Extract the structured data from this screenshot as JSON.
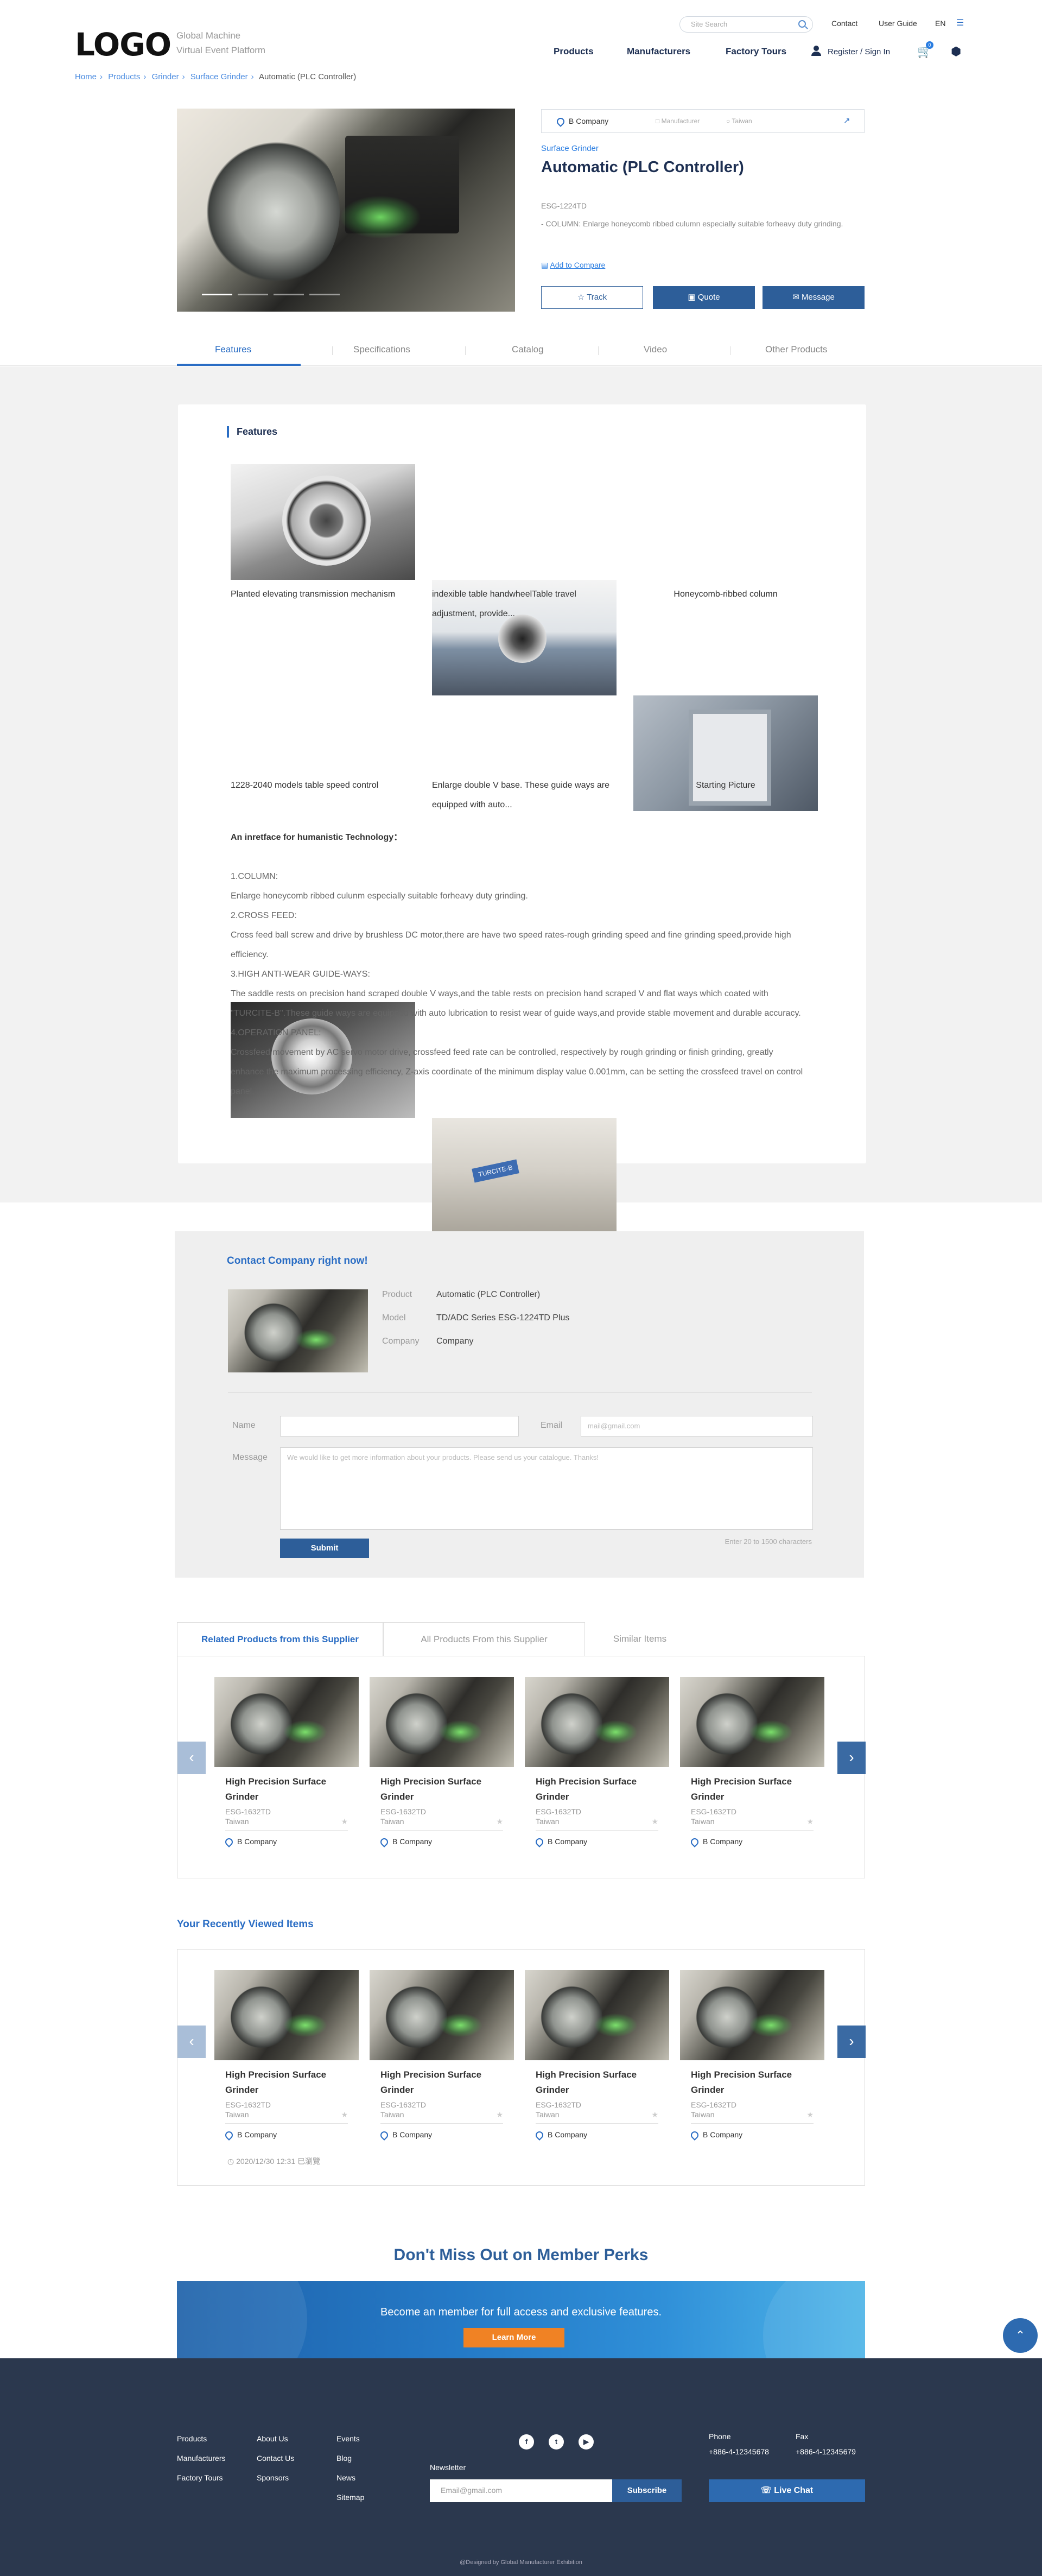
{
  "header": {
    "logo": "LOGO",
    "logo_sub1": "Global Machine",
    "logo_sub2": "Virtual Event Platform",
    "search_placeholder": "Site Search",
    "top_links": [
      "Contact",
      "User Guide",
      "EN"
    ],
    "nav": [
      "Products",
      "Manufacturers",
      "Factory Tours"
    ],
    "register": "Register / Sign In",
    "cart_count": "0"
  },
  "breadcrumb": [
    "Home",
    "Products",
    "Grinder",
    "Surface Grinder",
    "Automatic (PLC Controller)"
  ],
  "product": {
    "company": "B Company",
    "company_meta1": "Manufacturer",
    "company_meta2": "Taiwan",
    "category": "Surface Grinder",
    "title": "Automatic (PLC Controller)",
    "model": "ESG-1224TD",
    "desc": "- COLUMN: Enlarge honeycomb ribbed culumn especially suitable forheavy duty grinding.",
    "compare": "Add to Compare",
    "buttons": {
      "track": "Track",
      "quote": "Quote",
      "message": "Message"
    }
  },
  "tabs": [
    "Features",
    "Specifications",
    "Catalog",
    "Video",
    "Other Products"
  ],
  "features": {
    "title": "Features",
    "items": [
      "Planted elevating transmission mechanism",
      "indexible table handwheelTable travel adjustment, provide...",
      "Honeycomb-ribbed column",
      "1228-2040 models table speed control",
      "Enlarge double V base. These guide ways are equipped with auto...",
      "Starting Picture"
    ],
    "heading": "An inretface for humanistic Technology：",
    "lines": [
      "1.COLUMN:",
      "Enlarge honeycomb ribbed culunm especially suitable forheavy duty grinding.",
      "2.CROSS FEED:",
      "Cross feed ball screw and drive by brushless DC motor,there are have two speed rates-rough grinding speed and fine grinding speed,provide high efficiency.",
      "3.HIGH ANTI-WEAR GUIDE-WAYS:",
      "The saddle rests on precision hand scraped double V ways,and the table rests on precision hand scraped V and flat ways which coated with \"TURCITE-B\".These guide ways are equipped with auto lubrication to resist wear of guide ways,and provide stable movement and durable accuracy.",
      "4.OPERATION PANEL:",
      "Crossfeed movement by AC servo motor drive, crossfeed feed rate can be controlled, respectively by rough grinding or finish grinding, greatly enhance the maximum processing efficiency, Z-axis coordinate of the minimum display value 0.001mm, can be setting the crossfeed travel on control panel."
    ]
  },
  "contact": {
    "title": "Contact Company right now!",
    "product_label": "Product",
    "product_value": "Automatic (PLC Controller)",
    "model_label": "Model",
    "model_value": "TD/ADC Series ESG-1224TD Plus",
    "company_label": "Company",
    "company_value": "Company",
    "name_label": "Name",
    "email_label": "Email",
    "email_placeholder": "mail@gmail.com",
    "message_label": "Message",
    "message_placeholder": "We would like to get more information about your products. Please send us your catalogue. Thanks!",
    "submit": "Submit",
    "hint": "Enter 20 to 1500 characters"
  },
  "related": {
    "tabs": [
      "Related Products from this Supplier",
      "All Products From this Supplier",
      "Similar Items"
    ],
    "cards": [
      {
        "name": "High Precision Surface Grinder",
        "model": "ESG-1632TD",
        "location": "Taiwan",
        "company": "B Company"
      },
      {
        "name": "High Precision Surface Grinder",
        "model": "ESG-1632TD",
        "location": "Taiwan",
        "company": "B Company"
      },
      {
        "name": "High Precision Surface Grinder",
        "model": "ESG-1632TD",
        "location": "Taiwan",
        "company": "B Company"
      },
      {
        "name": "High Precision Surface Grinder",
        "model": "ESG-1632TD",
        "location": "Taiwan",
        "company": "B Company"
      }
    ]
  },
  "recent": {
    "title": "Your Recently Viewed Items",
    "cards": [
      {
        "name": "High Precision Surface Grinder",
        "model": "ESG-1632TD",
        "location": "Taiwan",
        "company": "B Company"
      },
      {
        "name": "High Precision Surface Grinder",
        "model": "ESG-1632TD",
        "location": "Taiwan",
        "company": "B Company"
      },
      {
        "name": "High Precision Surface Grinder",
        "model": "ESG-1632TD",
        "location": "Taiwan",
        "company": "B Company"
      },
      {
        "name": "High Precision Surface Grinder",
        "model": "ESG-1632TD",
        "location": "Taiwan",
        "company": "B Company"
      }
    ],
    "timestamp": "2020/12/30 12:31 已瀏覽"
  },
  "perks": {
    "title": "Don't Miss Out on Member Perks",
    "text": "Become an member for full access and exclusive features.",
    "button": "Learn More"
  },
  "footer": {
    "col1": [
      "Products",
      "Manufacturers",
      "Factory Tours"
    ],
    "col2": [
      "About Us",
      "Contact Us",
      "Sponsors"
    ],
    "col3": [
      "Events",
      "Blog",
      "News",
      "Sitemap"
    ],
    "newsletter_label": "Newsletter",
    "newsletter_placeholder": "Email@gmail.com",
    "subscribe": "Subscribe",
    "phone_label": "Phone",
    "phone": "+886-4-12345678",
    "fax_label": "Fax",
    "fax": "+886-4-12345679",
    "live_chat": "Live Chat",
    "copyright": "@Designed by Global Manufacturer Exhibition"
  }
}
